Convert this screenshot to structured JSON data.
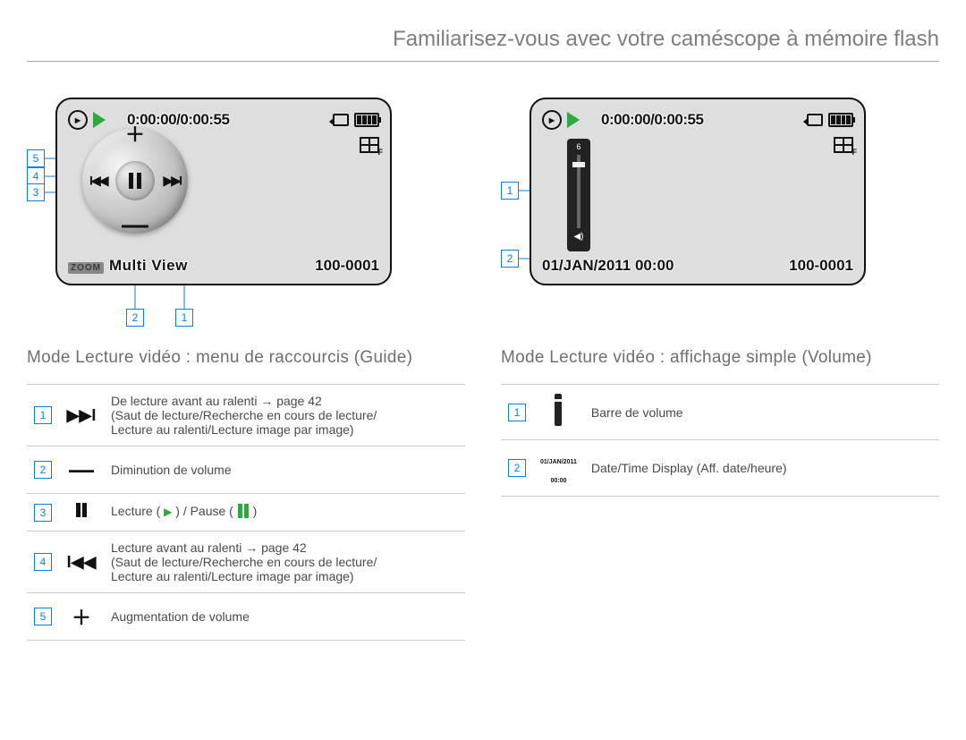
{
  "page_title": "Familiarisez-vous avec votre caméscope à mémoire flash",
  "screen": {
    "time": "0:00:00/0:00:55",
    "file_number": "100-0001",
    "zoom_label": "ZOOM",
    "multiview_label": "Multi View",
    "datetime": "01/JAN/2011 00:00",
    "vslider_top": "6"
  },
  "left": {
    "subtitle": "Mode Lecture vidéo : menu de raccourcis (Guide)",
    "callouts": [
      "5",
      "4",
      "3",
      "2",
      "1"
    ],
    "rows": [
      {
        "n": "1",
        "icon_text": "▶▶I",
        "desc_l1": "De lecture avant au ralenti → page 42",
        "desc_l2": "(Saut de lecture/Recherche en cours de lecture/",
        "desc_l3": "Lecture au ralenti/Lecture image par image)"
      },
      {
        "n": "2",
        "icon_text": "—",
        "desc_l1": "Diminution de volume"
      },
      {
        "n": "3",
        "icon_text": "II",
        "desc_pre": "Lecture ( ",
        "desc_post": " ) / Pause ( ",
        "desc_end": " )"
      },
      {
        "n": "4",
        "icon_text": "I◀◀",
        "desc_l1": "Lecture avant au ralenti → page 42",
        "desc_l2": "(Saut de lecture/Recherche en cours de lecture/",
        "desc_l3": "Lecture au ralenti/Lecture image par image)"
      },
      {
        "n": "5",
        "icon_text": "＋",
        "desc_l1": "Augmentation de volume"
      }
    ]
  },
  "right": {
    "subtitle": "Mode Lecture vidéo : affichage simple (Volume)",
    "callouts": [
      "1",
      "2"
    ],
    "rows": [
      {
        "n": "1",
        "desc_l1": "Barre de volume"
      },
      {
        "n": "2",
        "mini_date": "01/JAN/2011 00:00",
        "desc_l1": "Date/Time Display (Aff. date/heure)"
      }
    ]
  }
}
